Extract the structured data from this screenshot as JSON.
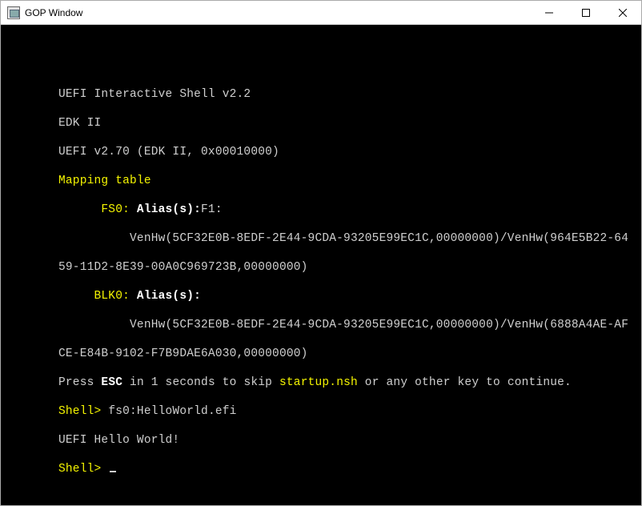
{
  "window": {
    "title": "GOP Window"
  },
  "term": {
    "l01": "UEFI Interactive Shell v2.2",
    "l02": "EDK II",
    "l03": "UEFI v2.70 (EDK II, 0x00010000)",
    "l04": "Mapping table",
    "l05a": "      FS0:",
    "l05b": " Alias(s):",
    "l05c": "F1:",
    "l06": "          VenHw(5CF32E0B-8EDF-2E44-9CDA-93205E99EC1C,00000000)/VenHw(964E5B22-64",
    "l07": "59-11D2-8E39-00A0C969723B,00000000)",
    "l08a": "     BLK0:",
    "l08b": " Alias(s):",
    "l09": "          VenHw(5CF32E0B-8EDF-2E44-9CDA-93205E99EC1C,00000000)/VenHw(6888A4AE-AF",
    "l10": "CE-E84B-9102-F7B9DAE6A030,00000000)",
    "l11a": "Press ",
    "l11b": "ESC",
    "l11c": " in 1 seconds to skip ",
    "l11d": "startup.nsh",
    "l11e": " or any other key to continue.",
    "l12a": "Shell>",
    "l12b": " fs0:HelloWorld.efi",
    "l13": "UEFI Hello World!",
    "l14a": "Shell>",
    "l14b": " "
  }
}
